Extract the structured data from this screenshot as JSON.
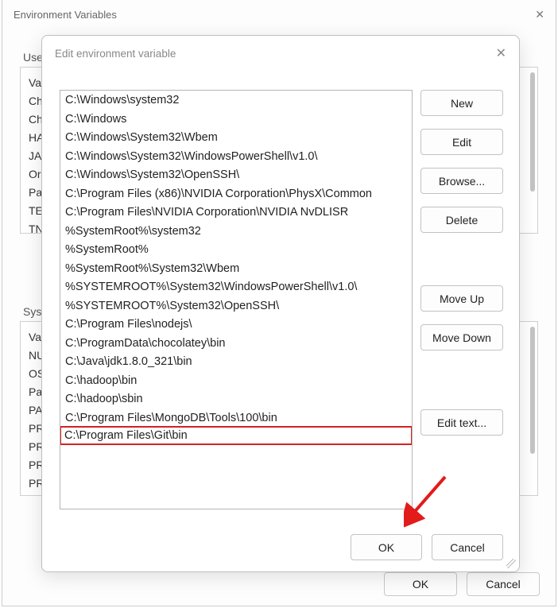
{
  "parent_dialog": {
    "title": "Environment Variables",
    "user_section_label": "User",
    "system_section_label": "Syste",
    "user_vars": [
      "Va",
      "Ch",
      "Ch",
      "HA",
      "JA",
      "Or",
      "Pa",
      "TE",
      "TN"
    ],
    "system_vars": [
      "Va",
      "NU",
      "OS",
      "Pa",
      "PA",
      "PR",
      "PR",
      "PR",
      "PR"
    ],
    "buttons": {
      "ok": "OK",
      "cancel": "Cancel"
    }
  },
  "edit_dialog": {
    "title": "Edit environment variable",
    "path_entries": [
      "C:\\Windows\\system32",
      "C:\\Windows",
      "C:\\Windows\\System32\\Wbem",
      "C:\\Windows\\System32\\WindowsPowerShell\\v1.0\\",
      "C:\\Windows\\System32\\OpenSSH\\",
      "C:\\Program Files (x86)\\NVIDIA Corporation\\PhysX\\Common",
      "C:\\Program Files\\NVIDIA Corporation\\NVIDIA NvDLISR",
      "%SystemRoot%\\system32",
      "%SystemRoot%",
      "%SystemRoot%\\System32\\Wbem",
      "%SYSTEMROOT%\\System32\\WindowsPowerShell\\v1.0\\",
      "%SYSTEMROOT%\\System32\\OpenSSH\\",
      "C:\\Program Files\\nodejs\\",
      "C:\\ProgramData\\chocolatey\\bin",
      "C:\\Java\\jdk1.8.0_321\\bin",
      "C:\\hadoop\\bin",
      "C:\\hadoop\\sbin",
      "C:\\Program Files\\MongoDB\\Tools\\100\\bin",
      "C:\\Program Files\\Git\\bin"
    ],
    "highlight_index": 18,
    "buttons": {
      "new": "New",
      "edit": "Edit",
      "browse": "Browse...",
      "delete": "Delete",
      "move_up": "Move Up",
      "move_down": "Move Down",
      "edit_text": "Edit text...",
      "ok": "OK",
      "cancel": "Cancel"
    }
  },
  "annotation": {
    "arrow_color": "#e21b1b"
  }
}
